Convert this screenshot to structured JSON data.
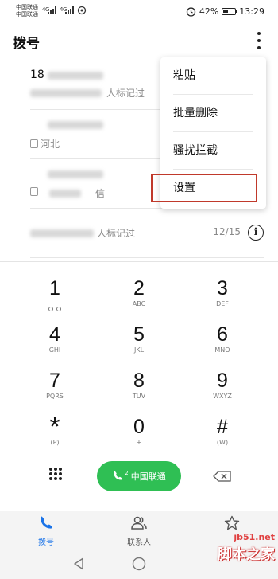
{
  "status_bar": {
    "carrier_1": "中国联通",
    "carrier_2": "中国联通",
    "network_1": "4G",
    "network_2": "4G",
    "battery": "42%",
    "time": "13:29"
  },
  "app_bar": {
    "title": "拨号",
    "more_icon": "more-vert-icon"
  },
  "call_log": [
    {
      "number": "18",
      "note": "人标记过"
    },
    {
      "sim": "2",
      "location": "河北"
    },
    {
      "sim": "2",
      "location": "",
      "note": "信"
    },
    {
      "note": "人标记过",
      "date": "12/15"
    }
  ],
  "menu": {
    "items": [
      "粘贴",
      "批量删除",
      "骚扰拦截",
      "设置"
    ],
    "highlighted": "设置"
  },
  "dialpad": {
    "keys": [
      {
        "digit": "1",
        "letters": ""
      },
      {
        "digit": "2",
        "letters": "ABC"
      },
      {
        "digit": "3",
        "letters": "DEF"
      },
      {
        "digit": "4",
        "letters": "GHI"
      },
      {
        "digit": "5",
        "letters": "JKL"
      },
      {
        "digit": "6",
        "letters": "MNO"
      },
      {
        "digit": "7",
        "letters": "PQRS"
      },
      {
        "digit": "8",
        "letters": "TUV"
      },
      {
        "digit": "9",
        "letters": "WXYZ"
      },
      {
        "digit": "*",
        "letters": "(P)"
      },
      {
        "digit": "0",
        "letters": "+"
      },
      {
        "digit": "#",
        "letters": "(W)"
      }
    ],
    "call_button": {
      "sim": "2",
      "label": "中国联通",
      "color": "#2fbf54"
    }
  },
  "bottom_nav": [
    {
      "label": "拨号",
      "icon": "phone-icon",
      "active": true
    },
    {
      "label": "联系人",
      "icon": "contacts-icon",
      "active": false
    },
    {
      "label": "",
      "icon": "star-icon",
      "active": false
    }
  ],
  "watermark": {
    "url": "jb51.net",
    "text": "脚本之家"
  },
  "colors": {
    "accent": "#1a73e8",
    "call_green": "#2fbf54",
    "highlight_red": "#c0392b"
  }
}
